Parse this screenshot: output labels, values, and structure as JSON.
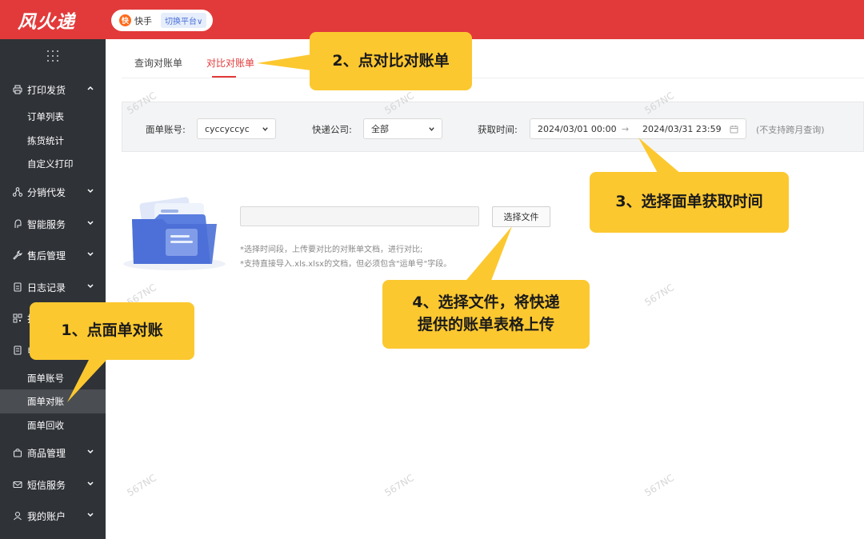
{
  "header": {
    "logo_text": "风火递",
    "platform_icon_text": "快",
    "platform_name": "快手",
    "switch_label": "切换平台∨"
  },
  "sidebar": {
    "groups": [
      {
        "label": "打印发货",
        "icon": "printer-icon",
        "expanded": true
      },
      {
        "label": "分销代发",
        "icon": "share-icon"
      },
      {
        "label": "智能服务",
        "icon": "smart-icon"
      },
      {
        "label": "售后管理",
        "icon": "wrench-icon"
      },
      {
        "label": "日志记录",
        "icon": "log-icon"
      },
      {
        "label": "打",
        "icon": "scan-icon"
      },
      {
        "label": "电",
        "icon": "doc-icon",
        "expanded": true
      },
      {
        "label": "商品管理",
        "icon": "bag-icon"
      },
      {
        "label": "短信服务",
        "icon": "mail-icon"
      },
      {
        "label": "我的账户",
        "icon": "user-icon"
      }
    ],
    "print_sub": [
      "订单列表",
      "拣货统计",
      "自定义打印"
    ],
    "waybill_sub": [
      "面单账号",
      "面单对账",
      "面单回收"
    ],
    "active_sub": "面单对账"
  },
  "tabs": [
    {
      "label": "查询对账单",
      "active": false
    },
    {
      "label": "对比对账单",
      "active": true
    }
  ],
  "filters": {
    "account_label": "面单账号:",
    "account_value": "cyccyccyc",
    "company_label": "快递公司:",
    "company_value": "全部",
    "time_label": "获取时间:",
    "date_start": "2024/03/01 00:00",
    "date_sep": "→",
    "date_end": "2024/03/31 23:59",
    "hint": "(不支持跨月查询)"
  },
  "upload": {
    "button_label": "选择文件",
    "note1": "*选择时间段，上传要对比的对账单文档，进行对比;",
    "note2": "*支持直接导入.xls.xlsx的文档，但必须包含\"运单号\"字段。"
  },
  "watermark": "567NC",
  "callouts": {
    "step1": "1、点面单对账",
    "step2": "2、点对比对账单",
    "step3": "3、选择面单获取时间",
    "step4_line1": "4、选择文件，将快递",
    "step4_line2": "提供的账单表格上传"
  },
  "colors": {
    "brand_red": "#e23a3a",
    "sidebar_bg": "#2f3237",
    "callout_yellow": "#fcc830"
  }
}
